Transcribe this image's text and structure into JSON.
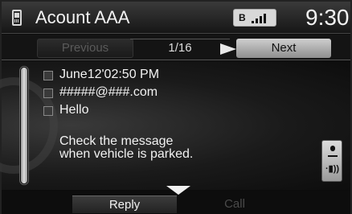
{
  "header": {
    "title": "Acount AAA",
    "bluetooth": "B",
    "clock": "9:30"
  },
  "nav": {
    "previous_label": "Previous",
    "page_indicator": "1/16",
    "next_label": "Next"
  },
  "message": {
    "date": "June12'02:50 PM",
    "sender": "#####@###.com",
    "subject": "Hello",
    "body_line1": "Check the message",
    "body_line2": "when vehicle is parked."
  },
  "speaker_button_text": "·▮))",
  "footer": {
    "reply_label": "Reply",
    "call_label": "Call"
  },
  "colors": {
    "header_bg": "#262626",
    "active_tab": "#c8c8c8",
    "disabled_text": "#5a5a5a"
  }
}
